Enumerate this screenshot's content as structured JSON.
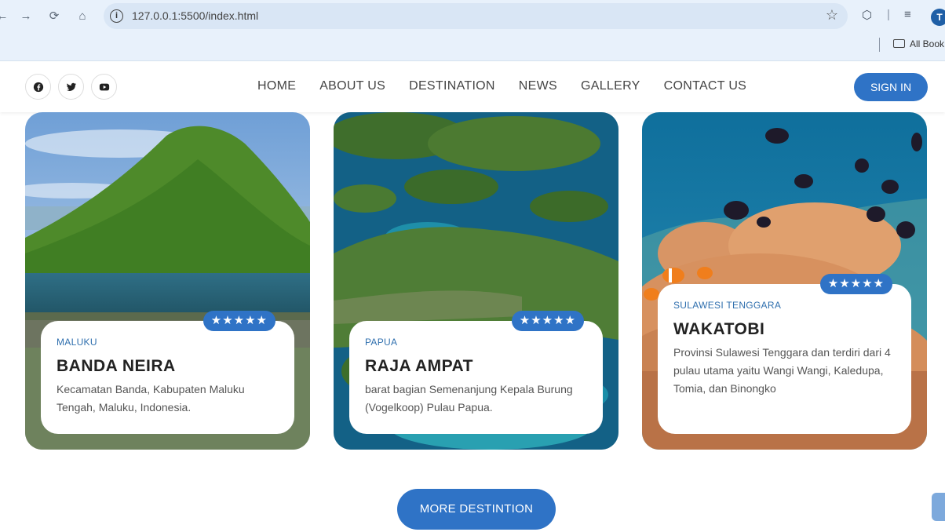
{
  "browser": {
    "url": "127.0.0.1:5500/index.html",
    "bookmarks_label": "All Book",
    "profile_initial": "T"
  },
  "header": {
    "menu": [
      "HOME",
      "ABOUT US",
      "DESTINATION",
      "NEWS",
      "GALLERY",
      "CONTACT US"
    ],
    "signin_label": "SIGN IN"
  },
  "cards": [
    {
      "rating": "★★★★★",
      "region": "MALUKU",
      "title": "BANDA NEIRA",
      "desc": "Kecamatan Banda, Kabupaten Maluku Tengah, Maluku, Indonesia."
    },
    {
      "rating": "★★★★★",
      "region": "PAPUA",
      "title": "RAJA AMPAT",
      "desc": "barat bagian Semenanjung Kepala Burung (Vogelkoop) Pulau Papua."
    },
    {
      "rating": "★★★★★",
      "region": "SULAWESI TENGGARA",
      "title": "WAKATOBI",
      "desc": "Provinsi Sulawesi Tenggara dan terdiri dari 4 pulau utama yaitu Wangi Wangi, Kaledupa, Tomia, dan Binongko"
    }
  ],
  "more_button": "MORE DESTINTION",
  "colors": {
    "accent": "#2f73c6"
  }
}
